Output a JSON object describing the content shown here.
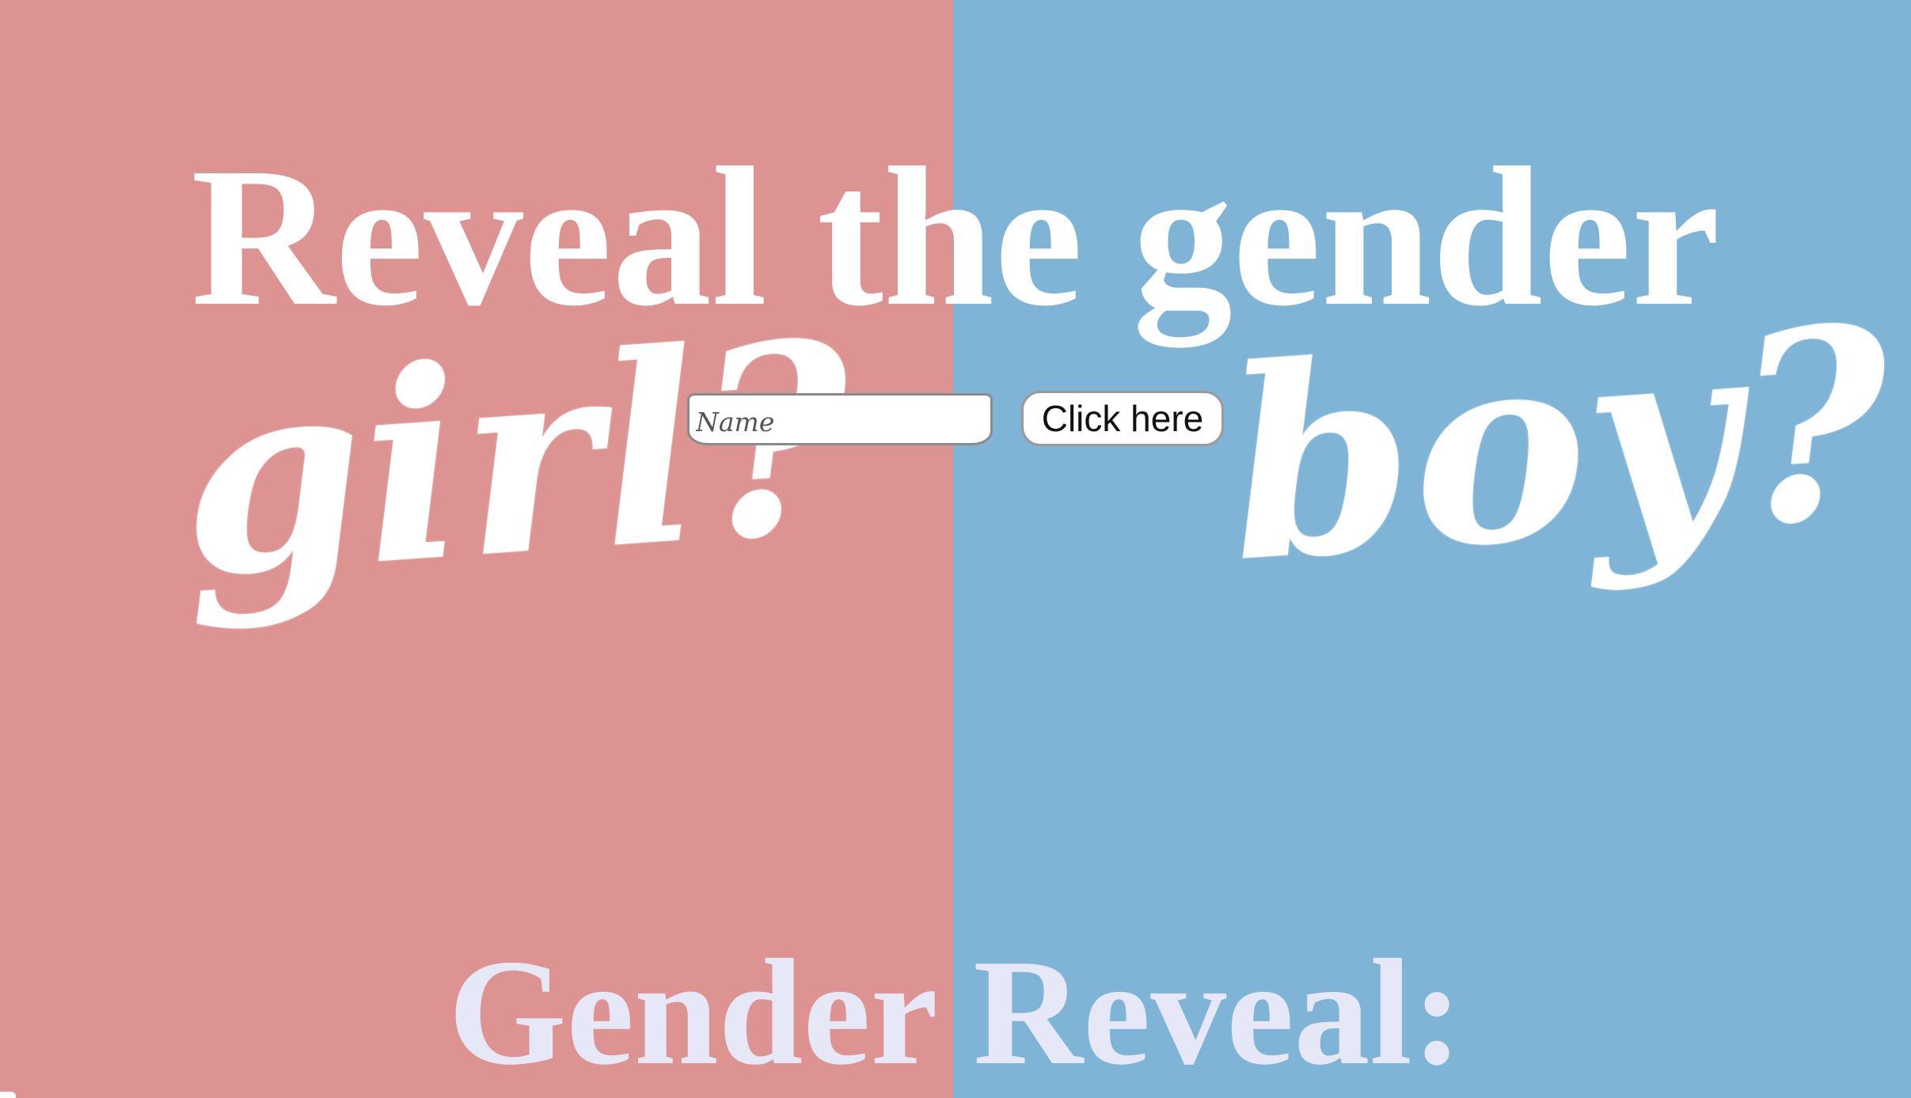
{
  "page": {
    "title": "Reveal the gender",
    "colors": {
      "left_background": "#dd9391",
      "right_background": "#7fb4d7",
      "title_text": "#ffffff",
      "footer_text": "#e6e8f7"
    }
  },
  "choices": {
    "left_label": "girl?",
    "right_label": "boy?"
  },
  "form": {
    "name_placeholder": "Name",
    "name_value": "",
    "submit_label": "Click here"
  },
  "result": {
    "label": "Gender Reveal:"
  }
}
